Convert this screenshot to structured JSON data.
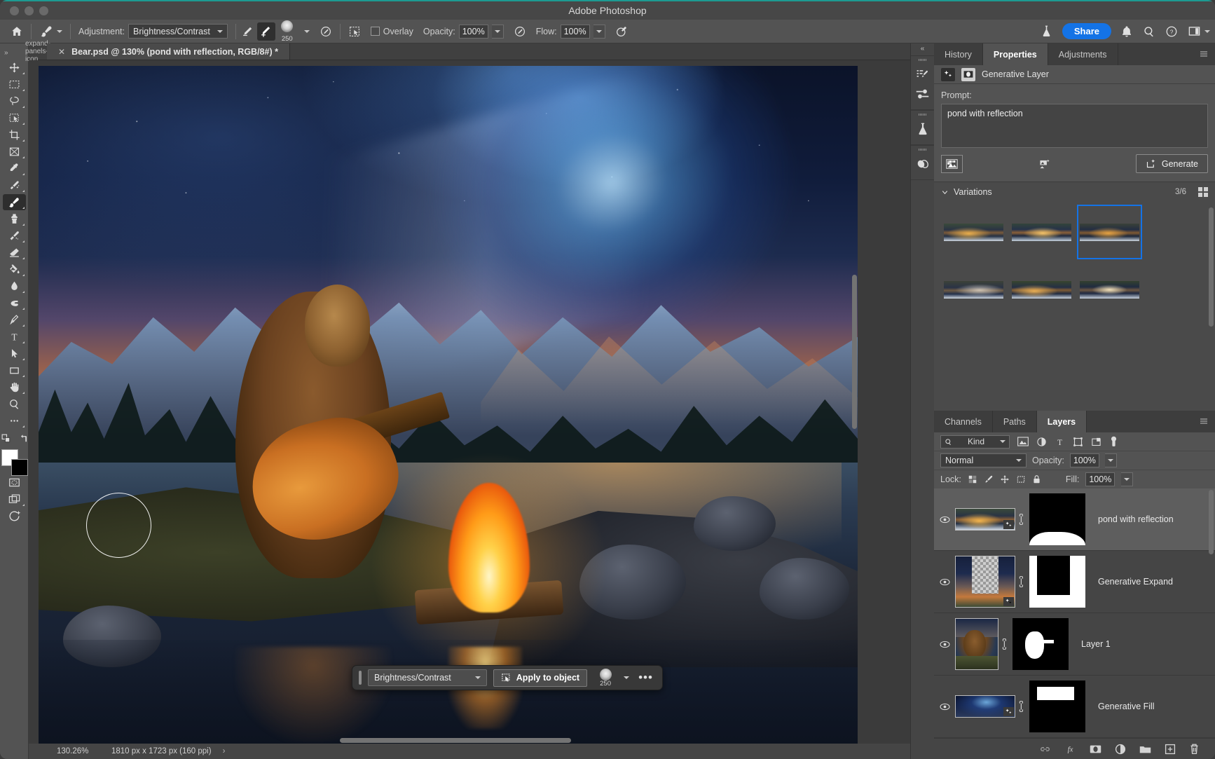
{
  "window": {
    "app_title": "Adobe Photoshop"
  },
  "options_bar": {
    "home_icon": "home-icon",
    "brush_tool_icon": "brush-tool-icon",
    "adjustment_label": "Adjustment:",
    "adjustment_value": "Brightness/Contrast",
    "darken_icon": "brush-darken-icon",
    "lighten_icon": "brush-lighten-icon",
    "brush_size": "250",
    "brush_settings_icon": "brush-settings-icon",
    "selection_icon": "selection-mode-icon",
    "overlay_label": "Overlay",
    "opacity_label": "Opacity:",
    "opacity_value": "100%",
    "opacity_pressure_icon": "pressure-opacity-icon",
    "flow_label": "Flow:",
    "flow_value": "100%",
    "airbrush_icon": "airbrush-icon",
    "lab_icon": "lab-flask-icon",
    "share_label": "Share",
    "bell_icon": "notification-bell-icon",
    "search_icon": "search-icon",
    "help_icon": "help-circle-icon",
    "workspace_icon": "workspace-icon",
    "chevron_icon": "chevron-down-icon"
  },
  "toolbar": {
    "collapse_label": "»",
    "tools": [
      {
        "name": "move-tool",
        "icon": "move-icon"
      },
      {
        "name": "rectangular-marquee-tool",
        "icon": "marquee-icon"
      },
      {
        "name": "lasso-tool",
        "icon": "lasso-icon"
      },
      {
        "name": "object-selection-tool",
        "icon": "object-select-icon"
      },
      {
        "name": "crop-tool",
        "icon": "crop-icon"
      },
      {
        "name": "frame-tool",
        "icon": "frame-icon"
      },
      {
        "name": "eyedropper-tool",
        "icon": "eyedropper-icon"
      },
      {
        "name": "spot-healing-brush-tool",
        "icon": "healing-brush-icon"
      },
      {
        "name": "brush-tool",
        "icon": "brush-icon",
        "active": true
      },
      {
        "name": "clone-stamp-tool",
        "icon": "clone-stamp-icon"
      },
      {
        "name": "history-brush-tool",
        "icon": "history-brush-icon"
      },
      {
        "name": "eraser-tool",
        "icon": "eraser-icon"
      },
      {
        "name": "gradient-tool",
        "icon": "paint-bucket-icon"
      },
      {
        "name": "blur-tool",
        "icon": "blur-drop-icon"
      },
      {
        "name": "dodge-tool",
        "icon": "dodge-icon"
      },
      {
        "name": "pen-tool",
        "icon": "pen-icon"
      },
      {
        "name": "type-tool",
        "icon": "type-icon"
      },
      {
        "name": "path-selection-tool",
        "icon": "path-arrow-icon"
      },
      {
        "name": "rectangle-tool",
        "icon": "rectangle-icon"
      },
      {
        "name": "hand-tool",
        "icon": "hand-icon"
      },
      {
        "name": "zoom-tool",
        "icon": "zoom-magnifier-icon"
      },
      {
        "name": "edit-toolbar",
        "icon": "ellipsis-icon"
      }
    ],
    "swap_icon": "swap-colors-icon",
    "reset_icon": "reset-colors-icon",
    "foreground_color": "#ffffff",
    "background_color": "#000000",
    "quickmask_icon": "quick-mask-icon",
    "screenmode_icon": "screen-mode-icon",
    "gen_icon": "generative-icon"
  },
  "document": {
    "tab_title": "Bear.psd @ 130% (pond with reflection, RGB/8#) *",
    "close_icon": "close-icon",
    "collapse_icon": "expand-panels-icon"
  },
  "context_bar": {
    "adjustment_value": "Brightness/Contrast",
    "apply_label": "Apply to object",
    "apply_icon": "apply-to-object-icon",
    "brush_size": "250",
    "more_label": "•••"
  },
  "status_bar": {
    "zoom": "130.26%",
    "doc_size": "1810 px x 1723 px (160 ppi)",
    "chevron": "›"
  },
  "dock_rail": {
    "collapse_icon": "collapse-panels-icon",
    "icons": [
      {
        "name": "history-panel-icon"
      },
      {
        "name": "adjustments-panel-icon"
      },
      {
        "name": "discover-lab-icon"
      },
      {
        "name": "styles-panel-icon"
      }
    ]
  },
  "properties_panel": {
    "tabs": [
      {
        "label": "History",
        "active": false
      },
      {
        "label": "Properties",
        "active": true
      },
      {
        "label": "Adjustments",
        "active": false
      }
    ],
    "menu_icon": "panel-menu-icon",
    "layer_type_label": "Generative Layer",
    "gen_icon": "generative-layer-icon",
    "mask_icon": "layer-mask-icon",
    "prompt_label": "Prompt:",
    "prompt_value": "pond with reflection",
    "reference_icon": "reference-image-icon",
    "reference_upload_icon": "upload-reference-icon",
    "generate_label": "Generate",
    "generate_icon": "generate-sparkle-icon",
    "variations_label": "Variations",
    "variations_chevron": "chevron-down-icon",
    "variations_count": "3/6",
    "grid_view_icon": "grid-view-icon",
    "variations": [
      {
        "id": 1,
        "selected": false
      },
      {
        "id": 2,
        "selected": false
      },
      {
        "id": 3,
        "selected": true
      },
      {
        "id": 4,
        "selected": false
      },
      {
        "id": 5,
        "selected": false
      },
      {
        "id": 6,
        "selected": false
      }
    ]
  },
  "layers_panel": {
    "tabs": [
      {
        "label": "Channels",
        "active": false
      },
      {
        "label": "Paths",
        "active": false
      },
      {
        "label": "Layers",
        "active": true
      }
    ],
    "menu_icon": "panel-menu-icon",
    "filter_kind_label": "Kind",
    "filter_search_icon": "search-icon",
    "filter_icons": [
      {
        "name": "filter-pixel-icon"
      },
      {
        "name": "filter-adjustment-icon"
      },
      {
        "name": "filter-type-icon"
      },
      {
        "name": "filter-shape-icon"
      },
      {
        "name": "filter-smartobject-icon"
      },
      {
        "name": "filter-toggle-icon"
      }
    ],
    "blend_mode": "Normal",
    "opacity_label": "Opacity:",
    "opacity_value": "100%",
    "lock_label": "Lock:",
    "lock_icons": [
      {
        "name": "lock-transparent-pixels-icon"
      },
      {
        "name": "lock-image-pixels-icon"
      },
      {
        "name": "lock-position-icon"
      },
      {
        "name": "lock-artboard-icon"
      },
      {
        "name": "lock-all-icon"
      }
    ],
    "fill_label": "Fill:",
    "fill_value": "100%",
    "layers": [
      {
        "name": "pond with reflection",
        "visible": true,
        "selected": true,
        "linked": true,
        "generative": true,
        "mask": "bottom-band"
      },
      {
        "name": "Generative Expand",
        "visible": true,
        "selected": false,
        "linked": true,
        "generative": true,
        "mask": "center-black"
      },
      {
        "name": "Layer 1",
        "visible": true,
        "selected": false,
        "linked": true,
        "generative": false,
        "mask": "bear-shape"
      },
      {
        "name": "Generative Fill",
        "visible": true,
        "selected": false,
        "linked": true,
        "generative": true,
        "mask": "top-band"
      }
    ],
    "footer_icons": [
      {
        "name": "link-layers-icon"
      },
      {
        "name": "layer-styles-fx-icon"
      },
      {
        "name": "add-layer-mask-icon"
      },
      {
        "name": "new-adjustment-layer-icon"
      },
      {
        "name": "new-group-icon"
      },
      {
        "name": "new-layer-icon"
      },
      {
        "name": "delete-layer-icon"
      }
    ]
  }
}
